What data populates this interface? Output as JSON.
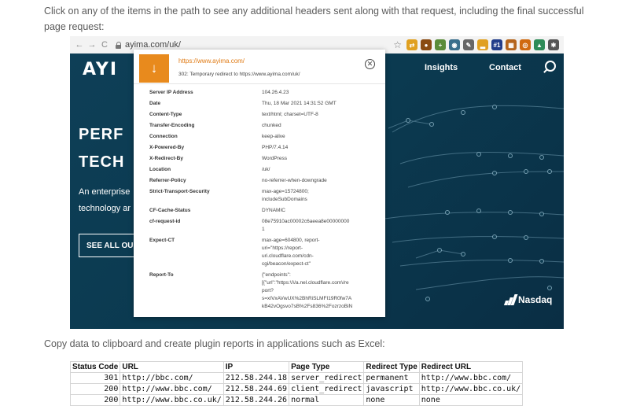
{
  "intro_text": "Click on any of the items in the path to see any additional headers sent along with that request, including the final successful page request:",
  "browser": {
    "back": "←",
    "forward": "→",
    "reload": "C",
    "url": "ayima.com/uk/",
    "extensions": [
      {
        "name": "redirect-path-icon",
        "color": "#e0a020",
        "glyph": "⇄"
      },
      {
        "name": "extension-icon",
        "color": "#8a4b12",
        "glyph": "●"
      },
      {
        "name": "plus-extension-icon",
        "color": "#5b8c3a",
        "glyph": "+"
      },
      {
        "name": "eye-extension-icon",
        "color": "#3a6f8c",
        "glyph": "◉"
      },
      {
        "name": "tool-extension-icon",
        "color": "#666666",
        "glyph": "✎"
      },
      {
        "name": "chart-extension-icon",
        "color": "#e0a020",
        "glyph": "▂"
      },
      {
        "name": "rank-extension-icon",
        "color": "#223d8a",
        "glyph": "#1"
      },
      {
        "name": "grid-extension-icon",
        "color": "#b5651d",
        "glyph": "▦"
      },
      {
        "name": "moz-extension-icon",
        "color": "#d06a10",
        "glyph": "◎"
      },
      {
        "name": "tree-extension-icon",
        "color": "#2e8b57",
        "glyph": "▲"
      },
      {
        "name": "puzzle-extension-icon",
        "color": "#555555",
        "glyph": "✱"
      }
    ]
  },
  "site": {
    "logo": "AYI",
    "nav_insights": "Insights",
    "nav_contact": "Contact",
    "hero_line1": "PERF",
    "hero_line2": "TECH",
    "hero_sub1": "An enterprise",
    "hero_sub2": "technology ar",
    "cta": "SEE ALL OU",
    "partner": "Nasdaq"
  },
  "popup": {
    "url": "https://www.ayima.com/",
    "status": "302: Temporary redirect to https://www.ayima.com/uk/",
    "headers": [
      {
        "key": "Server IP Address",
        "value": "104.26.4.23"
      },
      {
        "key": "Date",
        "value": "Thu, 18 Mar 2021 14:31:52 GMT"
      },
      {
        "key": "Content-Type",
        "value": "text/html; charset=UTF-8"
      },
      {
        "key": "Transfer-Encoding",
        "value": "chunked"
      },
      {
        "key": "Connection",
        "value": "keep-alive"
      },
      {
        "key": "X-Powered-By",
        "value": "PHP/7.4.14"
      },
      {
        "key": "X-Redirect-By",
        "value": "WordPress"
      },
      {
        "key": "Location",
        "value": "/uk/"
      },
      {
        "key": "Referrer-Policy",
        "value": "no-referrer-when-downgrade"
      },
      {
        "key": "Strict-Transport-Security",
        "value": "max-age=15724800;\nincludeSubDomains"
      },
      {
        "key": "CF-Cache-Status",
        "value": "DYNAMIC"
      },
      {
        "key": "cf-request-id",
        "value": "08e75910ac00002c6aeea8e00000000\n1"
      },
      {
        "key": "Expect-CT",
        "value": "max-age=604800, report-\nuri=\"https://report-\nuri.cloudflare.com/cdn-\ncgi/beacon/expect-ct\""
      },
      {
        "key": "Report-To",
        "value": "{\"endpoints\":\n[{\"url\":\"https:\\/\\/a.nel.cloudflare.com\\/re\nport?\ns=xIVxAVwUX%2BhRiSLMFI19R0fw7A\nkB42vOgsvo7sB%2Fs836%2FozrzoBiN"
      }
    ]
  },
  "copy_text": "Copy data to clipboard and create plugin reports in applications such as Excel:",
  "report": {
    "columns": [
      "Status Code",
      "URL",
      "IP",
      "Page Type",
      "Redirect Type",
      "Redirect URL"
    ],
    "rows": [
      [
        "301",
        "http://bbc.com/",
        "212.58.244.18",
        "server_redirect",
        "permanent",
        "http://www.bbc.com/"
      ],
      [
        "200",
        "http://www.bbc.com/",
        "212.58.244.69",
        "client_redirect",
        "javascript",
        "http://www.bbc.co.uk/"
      ],
      [
        "200",
        "http://www.bbc.co.uk/",
        "212.58.244.26",
        "normal",
        "none",
        "none"
      ]
    ]
  }
}
